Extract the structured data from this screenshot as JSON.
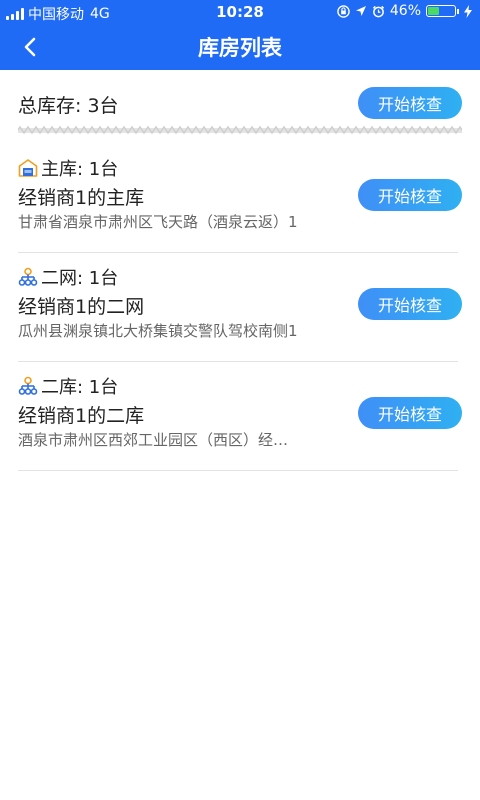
{
  "status_bar": {
    "carrier": "中国移动",
    "network": "4G",
    "time": "10:28",
    "battery": "46%",
    "battery_level": 0.46,
    "icons": [
      "orientation-lock-icon",
      "location-icon",
      "alarm-icon",
      "charging-icon"
    ]
  },
  "header": {
    "title": "库房列表",
    "back_icon": "back-arrow-icon"
  },
  "summary": {
    "total_label": "总库存: 3台",
    "button_label": "开始核查"
  },
  "warehouses": [
    {
      "icon": "warehouse-icon",
      "type_label": "主库: 1台",
      "name": "经销商1的主库",
      "address": "甘肃省酒泉市肃州区飞天路（酒泉云返）1",
      "button_label": "开始核查"
    },
    {
      "icon": "network-icon",
      "type_label": "二网: 1台",
      "name": "经销商1的二网",
      "address": "瓜州县渊泉镇北大桥集镇交警队驾校南侧1",
      "button_label": "开始核查"
    },
    {
      "icon": "network-icon",
      "type_label": "二库: 1台",
      "name": "经销商1的二库",
      "address": "酒泉市肃州区西郊工业园区（西区）经…",
      "button_label": "开始核查"
    }
  ],
  "colors": {
    "primary": "#1f6bf5",
    "button_start": "#3f8ff7",
    "button_end": "#2fb0f2",
    "battery": "#4cd964"
  }
}
